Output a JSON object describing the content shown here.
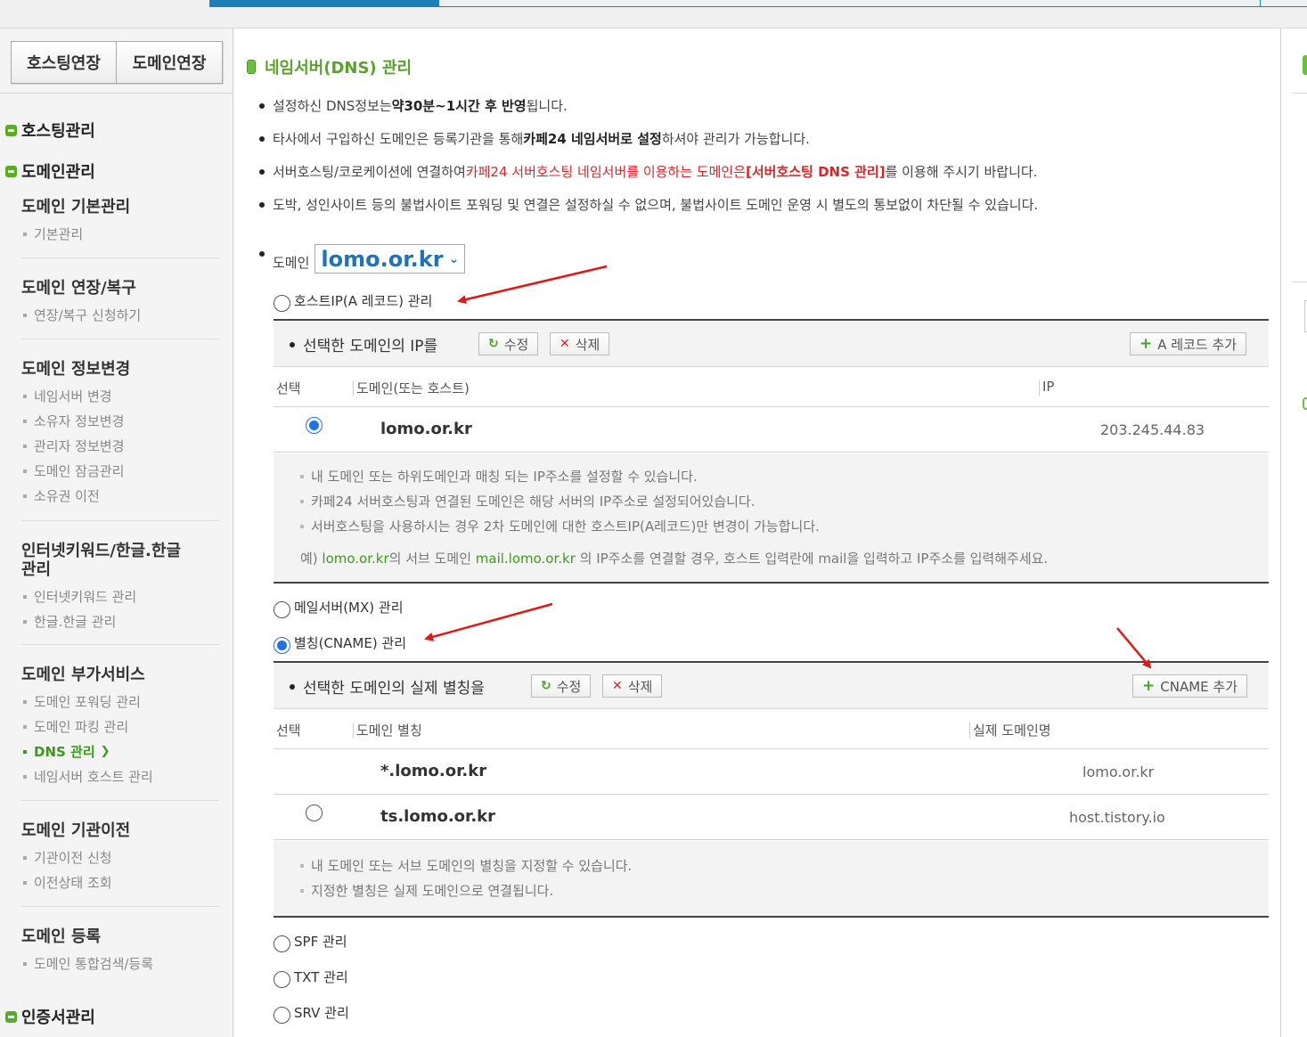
{
  "sidebar": {
    "ext_buttons": [
      "호스팅연장",
      "도메인연장"
    ],
    "main_sections": [
      "호스팅관리",
      "도메인관리",
      "인증서관리"
    ],
    "groups": [
      {
        "title": "도메인 기본관리",
        "items": [
          "기본관리"
        ]
      },
      {
        "title": "도메인 연장/복구",
        "items": [
          "연장/복구 신청하기"
        ]
      },
      {
        "title": "도메인 정보변경",
        "items": [
          "네임서버 변경",
          "소유자 정보변경",
          "관리자 정보변경",
          "도메인 잠금관리",
          "소유권 이전"
        ]
      },
      {
        "title_line1": "인터넷키워드/한글.한글",
        "title_line2": "관리",
        "items": [
          "인터넷키워드 관리",
          "한글.한글 관리"
        ]
      },
      {
        "title": "도메인 부가서비스",
        "items": [
          "도메인 포워딩 관리",
          "도메인 파킹 관리",
          "DNS 관리",
          "네임서버 호스트 관리"
        ],
        "active_index": 2
      },
      {
        "title": "도메인 기관이전",
        "items": [
          "기관이전 신청",
          "이전상태 조회"
        ]
      },
      {
        "title": "도메인 등록",
        "items": [
          "도메인 통합검색/등록"
        ]
      }
    ]
  },
  "page": {
    "title": "네임서버(DNS) 관리",
    "notices": {
      "n1_a": "설정하신 DNS정보는 ",
      "n1_b": "약30분~1시간 후 반영",
      "n1_c": "됩니다.",
      "n2_a": "타사에서 구입하신 도메인은 등록기관을 통해 ",
      "n2_b": "카페24 네임서버로 설정",
      "n2_c": "하셔야 관리가 가능합니다.",
      "n3_a": "서버호스팅/코로케이션에 연결하여 ",
      "n3_b": "카페24 서버호스팅 네임서버를 이용하는 도메인은",
      "n3_c": "[서버호스팅 DNS 관리]",
      "n3_d": "를 이용해 주시기 바랍니다.",
      "n4": "도박, 성인사이트 등의 불법사이트 포워딩 및 연결은 설정하실 수 없으며, 불법사이트 도메인 운영 시 별도의 통보없이 차단될 수 있습니다."
    },
    "domain_label": "도메인",
    "domain_selected": "lomo.or.kr"
  },
  "record_types": {
    "a": "호스트IP(A 레코드) 관리",
    "mx": "메일서버(MX) 관리",
    "cname": "별칭(CNAME) 관리",
    "spf": "SPF 관리",
    "txt": "TXT 관리",
    "srv": "SRV 관리",
    "selected": "cname"
  },
  "a_panel": {
    "heading": "선택한 도메인의 IP를",
    "edit_label": "수정",
    "delete_label": "삭제",
    "add_label": "A 레코드 추가",
    "columns": [
      "선택",
      "도메인(또는 호스트)",
      "IP"
    ],
    "rows": [
      {
        "domain": "lomo.or.kr",
        "ip": "203.245.44.83",
        "selected": true
      }
    ],
    "help": [
      "내 도메인 또는 하위도메인과 매칭 되는 IP주소를 설정할 수 있습니다.",
      "카페24 서버호스팅과 연결된 도메인은 해당 서버의 IP주소로 설정되어있습니다.",
      "서버호스팅을 사용하시는 경우 2차 도메인에 대한 호스트IP(A레코드)만 변경이 가능합니다."
    ],
    "example": {
      "prefix": "예) ",
      "domain": "lomo.or.kr",
      "mid1": "의 서브 도메인 ",
      "sub": "mail.lomo.or.kr",
      "rest": " 의 IP주소를 연결할 경우, 호스트 입력란에 mail을 입력하고 IP주소를 입력해주세요."
    }
  },
  "cname_panel": {
    "heading": "선택한 도메인의 실제 별칭을",
    "edit_label": "수정",
    "delete_label": "삭제",
    "add_label": "CNAME 추가",
    "columns": [
      "선택",
      "도메인 별칭",
      "실제 도메인명"
    ],
    "rows": [
      {
        "alias": "*.lomo.or.kr",
        "target": "lomo.or.kr",
        "has_radio": false
      },
      {
        "alias": "ts.lomo.or.kr",
        "target": "host.tistory.io",
        "has_radio": true
      }
    ],
    "help": [
      "내 도메인 또는 서브 도메인의 별칭을 지정할 수 있습니다.",
      "지정한 별칭은 실제 도메인으로 연결됩니다."
    ]
  },
  "colors": {
    "brand_green": "#5aa22e",
    "accent_blue": "#1f73b8",
    "warning_red": "#d9262b",
    "annotation_arrow": "#e01818"
  }
}
